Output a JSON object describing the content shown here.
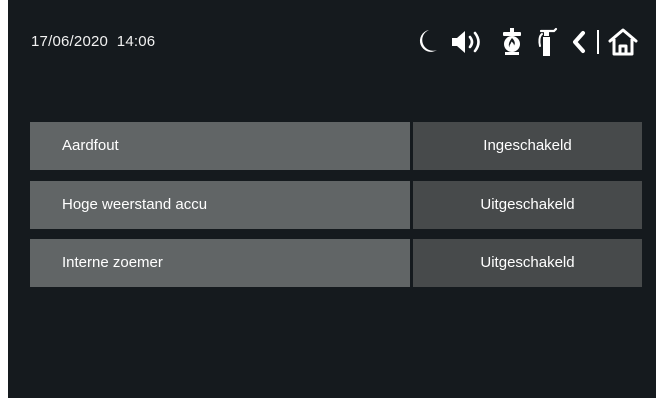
{
  "header": {
    "datetime": "17/06/2020  14:06",
    "icons": [
      "moon-icon",
      "speaker-icon",
      "fire-alarm-icon",
      "fire-extinguisher-icon",
      "back-icon",
      "home-icon"
    ]
  },
  "settings": [
    {
      "label": "Aardfout",
      "value": "Ingeschakeld"
    },
    {
      "label": "Hoge weerstand accu",
      "value": "Uitgeschakeld"
    },
    {
      "label": "Interne zoemer",
      "value": "Uitgeschakeld"
    }
  ],
  "colors": {
    "background": "#151a1e",
    "label_bg": "#616566",
    "value_bg": "#474a4b",
    "text": "#ffffff"
  }
}
